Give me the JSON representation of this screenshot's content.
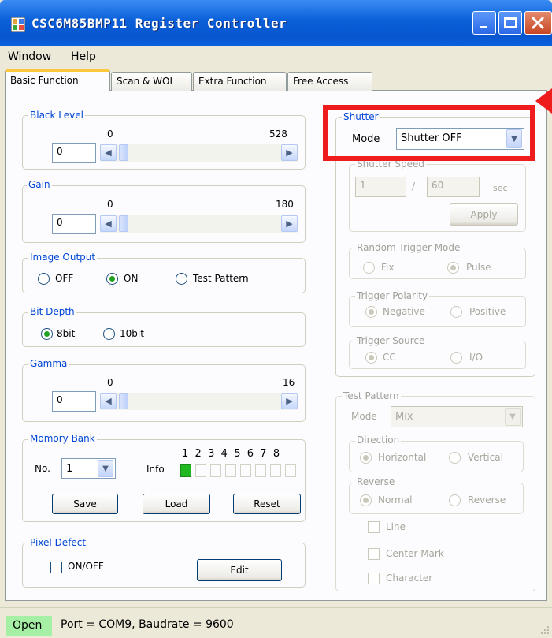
{
  "window": {
    "title": "CSC6M85BMP11 Register Controller"
  },
  "menu": [
    "Window",
    "Help"
  ],
  "tabs": [
    "Basic Function",
    "Scan & WOI",
    "Extra Function",
    "Free Access"
  ],
  "black_level": {
    "label": "Black Level",
    "min": "0",
    "max": "528",
    "value": "0"
  },
  "gain": {
    "label": "Gain",
    "min": "0",
    "max": "180",
    "value": "0"
  },
  "image_output": {
    "label": "Image Output",
    "options": [
      "OFF",
      "ON",
      "Test Pattern"
    ],
    "selected": "ON"
  },
  "bit_depth": {
    "label": "Bit Depth",
    "options": [
      "8bit",
      "10bit"
    ],
    "selected": "8bit"
  },
  "gamma": {
    "label": "Gamma",
    "min": "0",
    "max": "16",
    "value": "0"
  },
  "memory_bank": {
    "label": "Momory Bank",
    "no_label": "No.",
    "no_value": "1",
    "info_label": "Info",
    "slots": [
      "1",
      "2",
      "3",
      "4",
      "5",
      "6",
      "7",
      "8"
    ],
    "active_slot": "1",
    "save": "Save",
    "load": "Load",
    "reset": "Reset"
  },
  "pixel_defect": {
    "label": "Pixel Defect",
    "checkbox": "ON/OFF",
    "edit": "Edit"
  },
  "shutter": {
    "label": "Shutter",
    "mode_label": "Mode",
    "mode_value": "Shutter OFF",
    "speed_label": "Shutter Speed",
    "numerator": "1",
    "slash": "/",
    "denominator": "60",
    "unit": "sec",
    "apply": "Apply",
    "random_trigger": {
      "label": "Random Trigger Mode",
      "options": [
        "Fix",
        "Pulse"
      ],
      "selected": "Pulse"
    },
    "trigger_polarity": {
      "label": "Trigger Polarity",
      "options": [
        "Negative",
        "Positive"
      ],
      "selected": "Negative"
    },
    "trigger_source": {
      "label": "Trigger Source",
      "options": [
        "CC",
        "I/O"
      ],
      "selected": "CC"
    }
  },
  "test_pattern": {
    "label": "Test Pattern",
    "mode_label": "Mode",
    "mode_value": "Mix",
    "direction": {
      "label": "Direction",
      "options": [
        "Horizontal",
        "Vertical"
      ],
      "selected": "Horizontal"
    },
    "reverse": {
      "label": "Reverse",
      "options": [
        "Normal",
        "Reverse"
      ],
      "selected": "Normal"
    },
    "checkboxes": [
      "Line",
      "Center Mark",
      "Character"
    ]
  },
  "status": {
    "state": "Open",
    "text": "Port = COM9,  Baudrate = 9600"
  },
  "colors": {
    "title_bar": "#0a5fd8",
    "group_label": "#0046d5",
    "highlight": "#ee1c1c",
    "status_open": "#a6f0a6",
    "led_on": "#1fb81f"
  }
}
